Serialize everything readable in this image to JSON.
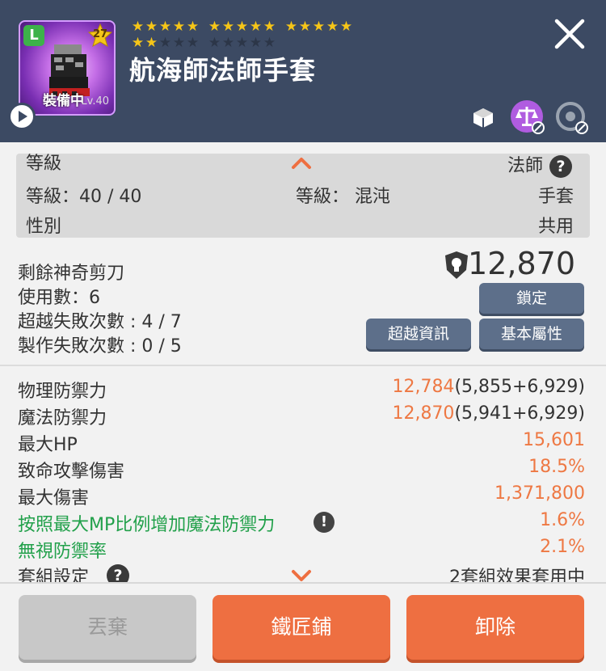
{
  "header": {
    "grade_badge": "L",
    "star_level": "27",
    "equipped_label": "裝備中",
    "level_small": "Lv.40",
    "item_name": "航海師法師手套",
    "stars": {
      "total": 25,
      "filled": 17
    },
    "icons": [
      "share-icon",
      "balance-icon",
      "transfer-icon"
    ]
  },
  "requirements": {
    "level_title": "等級",
    "class_label": "法師",
    "level_value": "等級：40 / 40",
    "chaos_label": "等級： 混沌",
    "type_label": "手套",
    "gender_label": "性別",
    "gender_value": "共用"
  },
  "upgrade": {
    "power_value": "12,870",
    "scissors": "剩餘神奇剪刀",
    "uses": "使用數：6",
    "transcend_fail": "超越失敗次數 : 4 / 7",
    "craft_fail": "製作失敗次數 : 0 / 5",
    "lock_button": "鎖定",
    "transcend_info_button": "超越資訊",
    "base_stats_button": "基本屬性"
  },
  "stats": [
    {
      "label": "物理防禦力",
      "total": "12,784",
      "detail": "(5,855+6,929)",
      "green": false
    },
    {
      "label": "魔法防禦力",
      "total": "12,870",
      "detail": "(5,941+6,929)",
      "green": false
    },
    {
      "label": "最大HP",
      "total": "15,601",
      "detail": "",
      "green": false
    },
    {
      "label": "致命攻擊傷害",
      "total": "18.5%",
      "detail": "",
      "green": false
    },
    {
      "label": "最大傷害",
      "total": "1,371,800",
      "detail": "",
      "green": false
    },
    {
      "label": "按照最大MP比例增加魔法防禦力",
      "total": "1.6%",
      "detail": "",
      "green": true
    },
    {
      "label": "無視防禦率",
      "total": "2.1%",
      "detail": "",
      "green": true
    }
  ],
  "set_info": {
    "label": "套組設定",
    "value": "2套組效果套用中"
  },
  "footer": {
    "discard": "丟棄",
    "blacksmith": "鐵匠鋪",
    "unequip": "卸除"
  },
  "colors": {
    "header_bg": "#3c4a63",
    "accent_orange": "#ee6f41",
    "stat_orange": "#ee7843",
    "stat_green": "#21a04a",
    "button_dark": "#5d6f8a",
    "star_gold": "#f5c518"
  }
}
